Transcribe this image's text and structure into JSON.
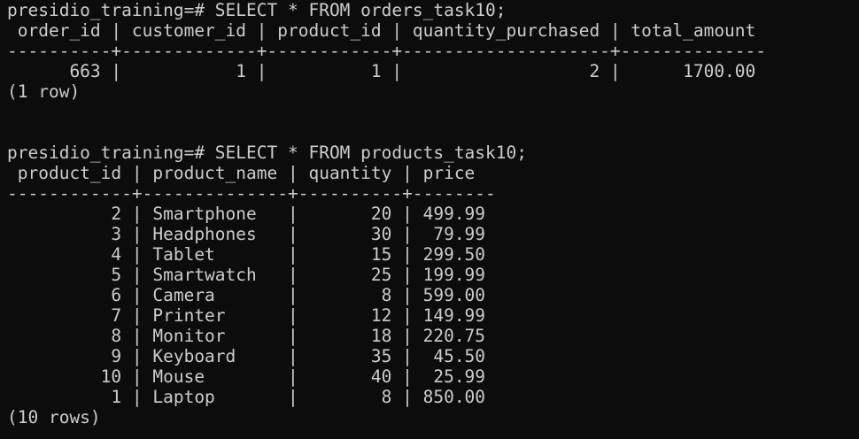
{
  "terminal": {
    "lines": [
      "presidio_training=# SELECT * FROM orders_task10;",
      " order_id | customer_id | product_id | quantity_purchased | total_amount",
      "----------+-------------+------------+--------------------+--------------",
      "      663 |           1 |          1 |                  2 |      1700.00",
      "(1 row)",
      "",
      "",
      "presidio_training=# SELECT * FROM products_task10;",
      " product_id | product_name | quantity | price",
      "------------+--------------+----------+--------",
      "          2 | Smartphone   |       20 | 499.99",
      "          3 | Headphones   |       30 |  79.99",
      "          4 | Tablet       |       15 | 299.50",
      "          5 | Smartwatch   |       25 | 199.99",
      "          6 | Camera       |        8 | 599.00",
      "          7 | Printer      |       12 | 149.99",
      "          8 | Monitor      |       18 | 220.75",
      "          9 | Keyboard     |       35 |  45.50",
      "         10 | Mouse        |       40 |  25.99",
      "          1 | Laptop       |        8 | 850.00",
      "(10 rows)",
      ""
    ]
  }
}
